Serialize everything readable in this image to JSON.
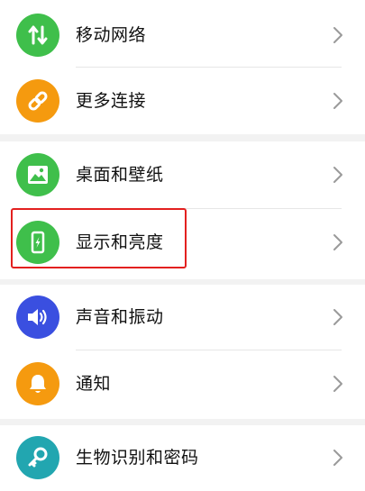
{
  "settings": {
    "items": [
      {
        "label": "移动网络",
        "icon": "arrows-updown-icon",
        "color": "#3fbf4b"
      },
      {
        "label": "更多连接",
        "icon": "link-icon",
        "color": "#f59a0f"
      },
      {
        "label": "桌面和壁纸",
        "icon": "image-icon",
        "color": "#3fbf4b"
      },
      {
        "label": "显示和亮度",
        "icon": "phone-brightness-icon",
        "color": "#3fbf4b"
      },
      {
        "label": "声音和振动",
        "icon": "speaker-icon",
        "color": "#3a4fe0"
      },
      {
        "label": "通知",
        "icon": "bell-icon",
        "color": "#f59a0f"
      },
      {
        "label": "生物识别和密码",
        "icon": "key-icon",
        "color": "#22a6b0"
      }
    ]
  },
  "highlight_color": "#e3201f"
}
